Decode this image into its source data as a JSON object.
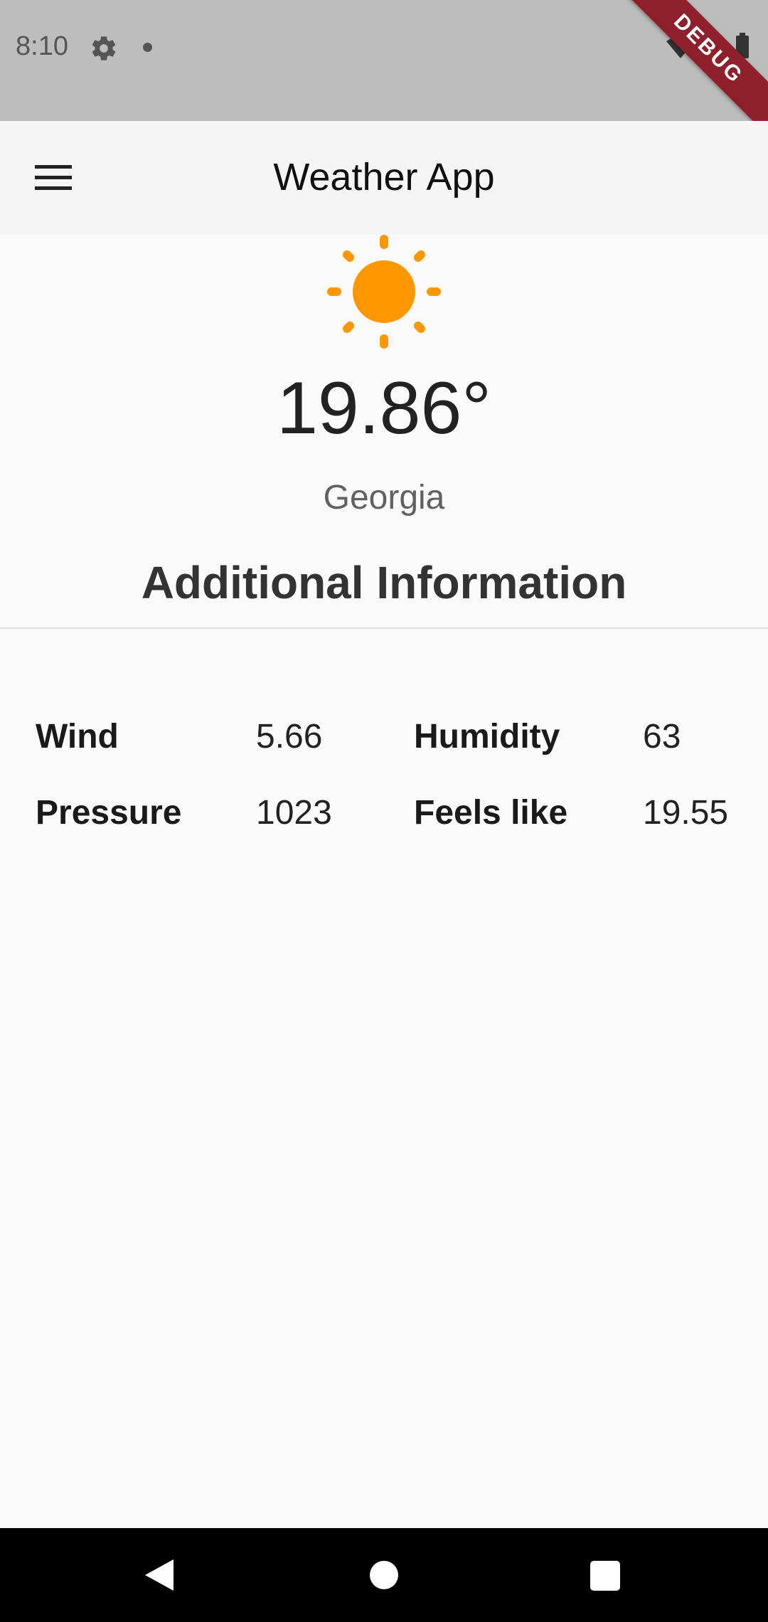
{
  "status_bar": {
    "time": "8:10",
    "debug_label": "DEBUG"
  },
  "app_bar": {
    "title": "Weather App"
  },
  "weather": {
    "temperature": "19.86°",
    "location": "Georgia",
    "icon": "sun-icon",
    "icon_color": "#ff9800"
  },
  "additional": {
    "title": "Additional Information",
    "wind_label": "Wind",
    "wind_value": "5.66",
    "humidity_label": "Humidity",
    "humidity_value": "63",
    "pressure_label": "Pressure",
    "pressure_value": "1023",
    "feels_like_label": "Feels like",
    "feels_like_value": "19.55"
  }
}
